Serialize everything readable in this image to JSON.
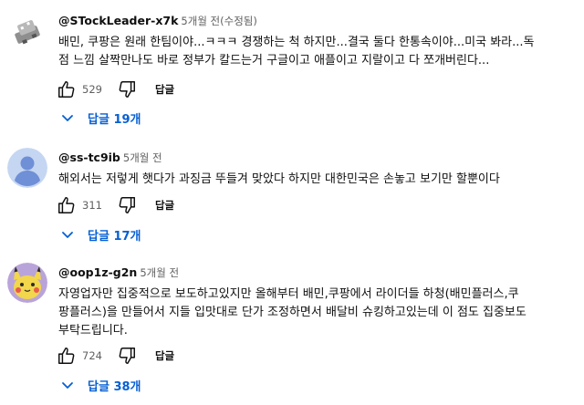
{
  "comments": [
    {
      "author": "@STockLeader-x7k",
      "time": "5개월 전(수정됨)",
      "text": "배민, 쿠팡은 원래 한팀이야...ㅋㅋㅋ 경쟁하는 척 하지만...결국 둘다 한통속이야...미국 봐라...독\n점 느낌 살짝만나도 바로 정부가 칼드는거 구글이고 애플이고 지랄이고 다 쪼개버린다...",
      "likes": "529",
      "reply_label": "답글",
      "replies_label": "답글 19개",
      "avatar_icon": "robot-avatar"
    },
    {
      "author": "@ss-tc9ib",
      "time": "5개월 전",
      "text": "해외서는   저렇게 햇다가  과징금 뚜들겨 맞았다   하지만  대한민국은 손놓고  보기만  할뿐이다",
      "likes": "311",
      "reply_label": "답글",
      "replies_label": "답글 17개",
      "avatar_icon": "default-person-avatar"
    },
    {
      "author": "@oop1z-g2n",
      "time": "5개월 전",
      "text": "자영업자만 집중적으로 보도하고있지만 올해부터 배민,쿠팡에서 라이더들 하청(배민플러스,쿠\n팡플러스)을 만들어서 지들 입맛대로 단가 조정하면서 배달비 슈킹하고있는데 이 점도 집중보도\n부탁드립니다.",
      "likes": "724",
      "reply_label": "답글",
      "replies_label": "답글 38개",
      "avatar_icon": "pikachu-avatar"
    }
  ],
  "colors": {
    "link_blue": "#065fd4",
    "meta_gray": "#606060",
    "text": "#0f0f0f"
  }
}
